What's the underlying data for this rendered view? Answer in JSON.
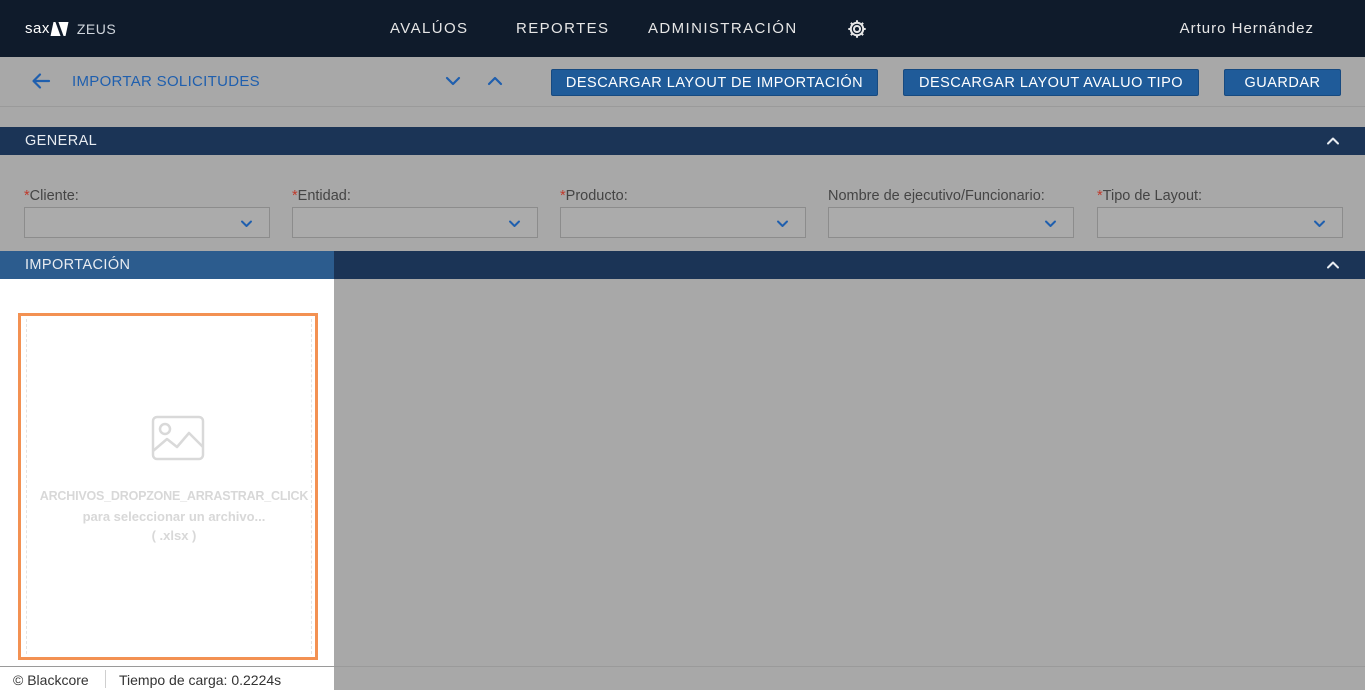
{
  "brand": {
    "logo_text": "sax",
    "app_name": "ZEUS"
  },
  "nav": {
    "items": [
      {
        "label": "AVALÚOS"
      },
      {
        "label": "REPORTES"
      },
      {
        "label": "ADMINISTRACIÓN"
      }
    ]
  },
  "user": {
    "name": "Arturo Hernández"
  },
  "toolbar": {
    "title": "IMPORTAR SOLICITUDES",
    "download_import_layout_label": "DESCARGAR LAYOUT DE IMPORTACIÓN",
    "download_appraisal_layout_label": "DESCARGAR LAYOUT AVALUO TIPO",
    "save_label": "GUARDAR"
  },
  "general": {
    "title": "GENERAL",
    "fields": [
      {
        "required": true,
        "label": "Cliente:",
        "value": ""
      },
      {
        "required": true,
        "label": "Entidad:",
        "value": ""
      },
      {
        "required": true,
        "label": "Producto:",
        "value": ""
      },
      {
        "required": false,
        "label": "Nombre de ejecutivo/Funcionario:",
        "value": ""
      },
      {
        "required": true,
        "label": "Tipo de Layout:",
        "value": ""
      }
    ]
  },
  "importacion": {
    "title": "IMPORTACIÓN",
    "dropzone": {
      "line1": "ARCHIVOS_DROPZONE_ARRASTRAR_CLICK",
      "line2": "para seleccionar un archivo...",
      "line3": "( .xlsx )"
    }
  },
  "footer": {
    "copyright": "© Blackcore",
    "load_time": "Tiempo de carga: 0.2224s"
  },
  "colors": {
    "topbar": "#0f1b2b",
    "section_bar": "#1b3456",
    "active_tab": "#2c5c8e",
    "button": "#1f5b99",
    "link": "#1f5fae",
    "dropzone_border": "#f39152",
    "required": "#c0392b"
  },
  "icons": {
    "gear": "gear-icon",
    "back": "arrow-left-icon",
    "expand_down": "chevron-down-icon",
    "collapse_up": "chevron-up-icon",
    "upload_image": "image-placeholder-icon"
  }
}
